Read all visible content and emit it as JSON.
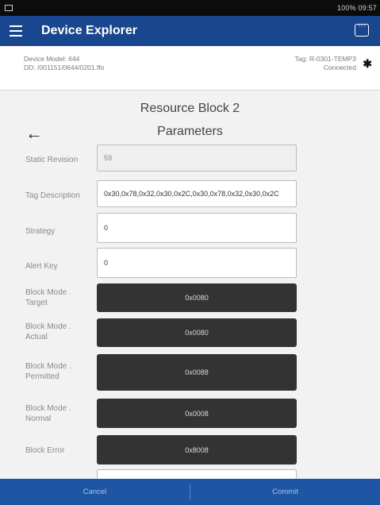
{
  "status_bar": {
    "right_text": "100% 09:57"
  },
  "app_bar": {
    "title": "Device Explorer"
  },
  "device_info": {
    "model": "Device Model: 644",
    "dd": "DD: /001151/0644/0201.ffo",
    "tag": "Tag: R-0301-TEMP3",
    "status": "Connected"
  },
  "page": {
    "title": "Resource Block 2",
    "subtitle": "Parameters"
  },
  "params": {
    "static_revision": {
      "label": "Static Revision",
      "value": "59"
    },
    "tag_description": {
      "label": "Tag Description",
      "value": "0x30,0x78,0x32,0x30,0x2C,0x30,0x78,0x32,0x30,0x2C"
    },
    "strategy": {
      "label": "Strategy",
      "value": "0"
    },
    "alert_key": {
      "label": "Alert Key",
      "value": "0"
    },
    "block_mode_target": {
      "label": "Block Mode . Target",
      "value": "0x0080"
    },
    "block_mode_actual": {
      "label": "Block Mode . Actual",
      "value": "0x0080"
    },
    "block_mode_permitted": {
      "label": "Block Mode . Permitted",
      "value": "0x0088"
    },
    "block_mode_normal": {
      "label": "Block Mode . Normal",
      "value": "0x0008"
    },
    "block_error": {
      "label": "Block Error",
      "value": "0x8008"
    }
  },
  "footer": {
    "cancel": "Cancel",
    "commit": "Commit"
  },
  "colors": {
    "app_bar": "#19478f",
    "footer": "#1f55a5",
    "mode_button": "#333333"
  },
  "icons": {
    "menu": "hamburger-icon",
    "chat": "chat-icon",
    "bluetooth": "bluetooth-icon",
    "back": "back-arrow-icon"
  }
}
